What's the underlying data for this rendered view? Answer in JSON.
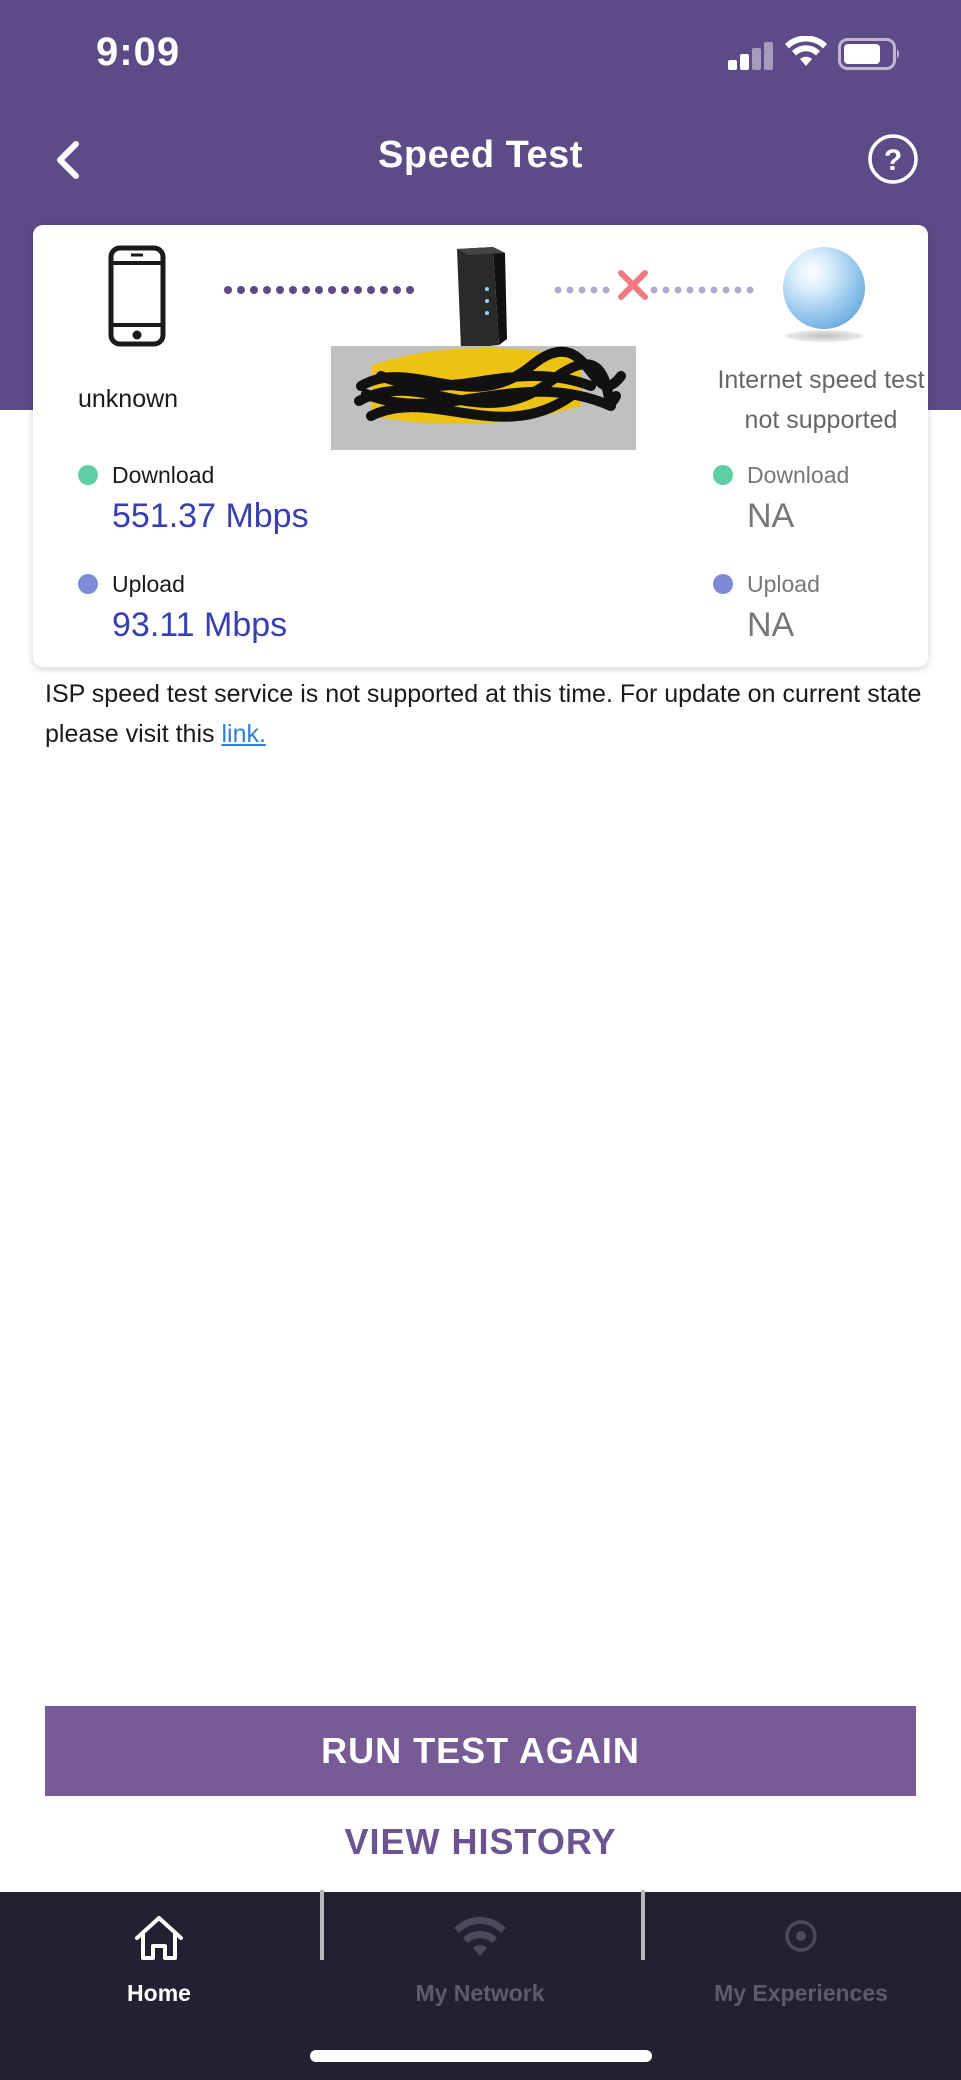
{
  "status_bar": {
    "time": "9:09"
  },
  "header": {
    "title": "Speed Test"
  },
  "card": {
    "device_label": "unknown",
    "internet_label_line1": "Internet speed test",
    "internet_label_line2": "not supported",
    "local": {
      "download_label": "Download",
      "download_value": "551.37 Mbps",
      "upload_label": "Upload",
      "upload_value": "93.11 Mbps"
    },
    "internet": {
      "download_label": "Download",
      "download_value": "NA",
      "upload_label": "Upload",
      "upload_value": "NA"
    }
  },
  "info": {
    "text": "ISP speed test service is not supported at this time. For update on current state please visit this ",
    "link_label": "link."
  },
  "actions": {
    "run_label": "RUN TEST AGAIN",
    "history_label": "VIEW HISTORY"
  },
  "bottom_nav": {
    "home_label": "Home",
    "network_label": "My Network",
    "experiences_label": "My Experiences"
  },
  "colors": {
    "brand_purple": "#5d4b87",
    "button_purple": "#765b97",
    "download_dot": "#5ecfa3",
    "upload_dot": "#7f8ad6",
    "value_blue": "#3a3fb0",
    "error_red": "#f07a7f",
    "nav_bg": "#212131"
  },
  "icons": [
    "chevron-left-icon",
    "question-circle-icon",
    "smartphone-icon",
    "router-icon",
    "globe-icon",
    "x-icon",
    "home-icon",
    "wifi-icon",
    "target-icon"
  ]
}
